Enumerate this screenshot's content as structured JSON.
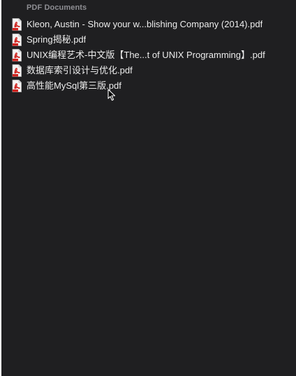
{
  "section": {
    "title": "PDF Documents"
  },
  "files": [
    {
      "name": "Kleon, Austin - Show your w...blishing Company (2014).pdf",
      "icon": "pdf-file-icon"
    },
    {
      "name": "Spring揭秘.pdf",
      "icon": "pdf-file-icon"
    },
    {
      "name": "UNIX编程艺术-中文版【The...t of UNIX Programming】.pdf",
      "icon": "pdf-file-icon"
    },
    {
      "name": "数据库索引设计与优化.pdf",
      "icon": "pdf-file-icon"
    },
    {
      "name": "高性能MySql第三版.pdf",
      "icon": "pdf-file-icon"
    }
  ],
  "colors": {
    "background": "#1f1f21",
    "header_text": "#8e8e93",
    "item_text": "#ececec",
    "pdf_icon_red": "#d0231e"
  }
}
